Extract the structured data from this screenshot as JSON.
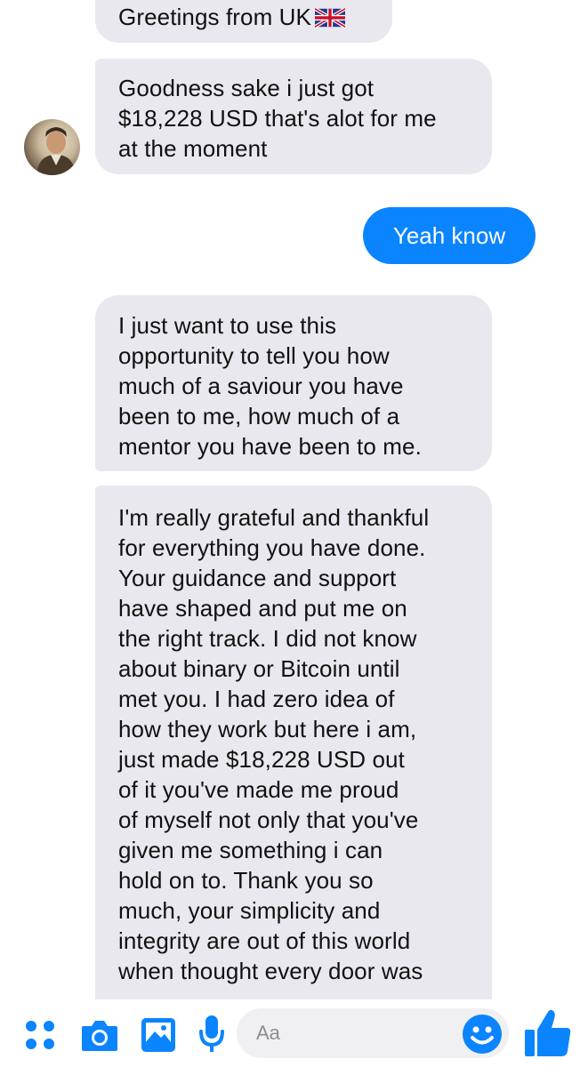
{
  "messages": [
    {
      "side": "incoming",
      "text": "Greetings from UK",
      "emoji": "uk-flag-icon"
    },
    {
      "side": "incoming",
      "text": "Goodness sake i just got\n$18,228 USD that's alot for me\nat the moment"
    },
    {
      "side": "outgoing",
      "text": "Yeah know"
    },
    {
      "side": "incoming",
      "text": "I just want to use this\nopportunity to tell you how\nmuch of a saviour you have\nbeen to me, how much of a\nmentor you have been to me."
    },
    {
      "side": "incoming",
      "text": "I'm really grateful and thankful\nfor everything you have done.\nYour guidance and support\nhave shaped and put me on\nthe right track. I did not know\nabout binary or Bitcoin until\nmet you. I had zero idea of\nhow they work but here i am,\njust made $18,228 USD out\nof it you've made me proud\nof myself not only that you've\ngiven me something i can\nhold on to. Thank you so\nmuch, your simplicity and\nintegrity are out of this world\nwhen thought every door was"
    }
  ],
  "composer": {
    "placeholder": "Aa",
    "icons": [
      "menu-dots-icon",
      "camera-icon",
      "gallery-icon",
      "microphone-icon",
      "emoji-icon",
      "thumbs-up-icon"
    ]
  },
  "colors": {
    "accent": "#0a84ff",
    "incoming_bubble": "#e9e8ee"
  }
}
